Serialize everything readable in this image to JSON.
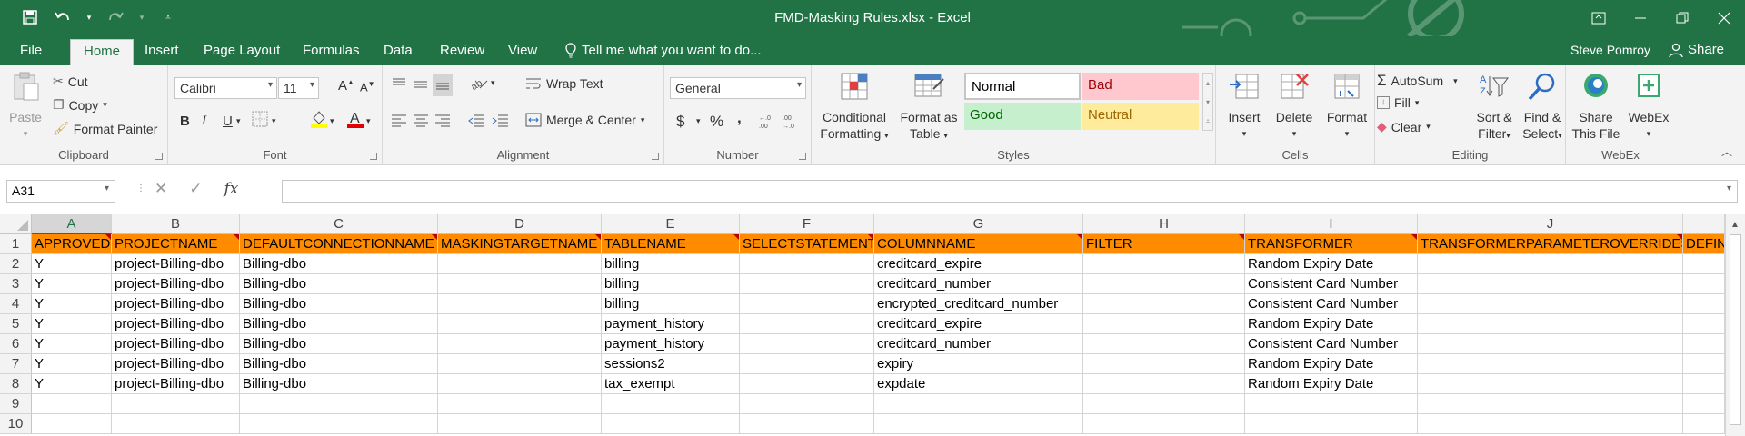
{
  "window": {
    "title": "FMD-Masking Rules.xlsx - Excel",
    "accent": "#217346"
  },
  "menu": {
    "file": "File",
    "tabs": [
      "Home",
      "Insert",
      "Page Layout",
      "Formulas",
      "Data",
      "Review",
      "View"
    ],
    "tell_me": "Tell me what you want to do...",
    "user": "Steve Pomroy",
    "share": "Share"
  },
  "ribbon": {
    "clipboard": {
      "label": "Clipboard",
      "paste": "Paste",
      "cut": "Cut",
      "copy": "Copy",
      "format_painter": "Format Painter"
    },
    "font": {
      "label": "Font",
      "name": "Calibri",
      "size": "11",
      "bold": "B",
      "italic": "I",
      "underline": "U"
    },
    "alignment": {
      "label": "Alignment",
      "wrap_text": "Wrap Text",
      "merge_center": "Merge & Center"
    },
    "number": {
      "label": "Number",
      "format": "General",
      "currency": "$",
      "percent": "%",
      "comma": ","
    },
    "styles": {
      "label": "Styles",
      "conditional_formatting": [
        "Conditional",
        "Formatting"
      ],
      "format_as_table": [
        "Format as",
        "Table"
      ],
      "normal": "Normal",
      "bad": "Bad",
      "good": "Good",
      "neutral": "Neutral"
    },
    "cells": {
      "label": "Cells",
      "insert": "Insert",
      "delete": "Delete",
      "format": "Format"
    },
    "editing": {
      "label": "Editing",
      "autosum": "AutoSum",
      "fill": "Fill",
      "clear": "Clear",
      "sort_filter": [
        "Sort &",
        "Filter"
      ],
      "find_select": [
        "Find &",
        "Select"
      ]
    },
    "webex": {
      "label": "WebEx",
      "share_file": [
        "Share",
        "This File"
      ],
      "webex": "WebEx"
    }
  },
  "formula_bar": {
    "name_box": "A31",
    "fx": "fx",
    "formula": ""
  },
  "sheet": {
    "selected_column": "A",
    "columns": [
      "A",
      "B",
      "C",
      "D",
      "E",
      "F",
      "G",
      "H",
      "I",
      "J"
    ],
    "row_numbers": [
      "1",
      "2",
      "3",
      "4",
      "5",
      "6",
      "7",
      "8",
      "9",
      "10"
    ],
    "header_row": [
      "APPROVED",
      "PROJECTNAME",
      "DEFAULTCONNECTIONNAME",
      "MASKINGTARGETNAME",
      "TABLENAME",
      "SELECTSTATEMENT",
      "COLUMNNAME",
      "FILTER",
      "TRANSFORMER",
      "TRANSFORMERPARAMETEROVERRIDES",
      "DEFIN"
    ],
    "rows": [
      [
        "Y",
        "project-Billing-dbo",
        "Billing-dbo",
        "",
        "billing",
        "",
        "creditcard_expire",
        "",
        "Random Expiry Date",
        "",
        ""
      ],
      [
        "Y",
        "project-Billing-dbo",
        "Billing-dbo",
        "",
        "billing",
        "",
        "creditcard_number",
        "",
        "Consistent Card Number",
        "",
        ""
      ],
      [
        "Y",
        "project-Billing-dbo",
        "Billing-dbo",
        "",
        "billing",
        "",
        "encrypted_creditcard_number",
        "",
        "Consistent Card Number",
        "",
        ""
      ],
      [
        "Y",
        "project-Billing-dbo",
        "Billing-dbo",
        "",
        "payment_history",
        "",
        "creditcard_expire",
        "",
        "Random Expiry Date",
        "",
        ""
      ],
      [
        "Y",
        "project-Billing-dbo",
        "Billing-dbo",
        "",
        "payment_history",
        "",
        "creditcard_number",
        "",
        "Consistent Card Number",
        "",
        ""
      ],
      [
        "Y",
        "project-Billing-dbo",
        "Billing-dbo",
        "",
        "sessions2",
        "",
        "expiry",
        "",
        "Random Expiry Date",
        "",
        ""
      ],
      [
        "Y",
        "project-Billing-dbo",
        "Billing-dbo",
        "",
        "tax_exempt",
        "",
        "expdate",
        "",
        "Random Expiry Date",
        "",
        ""
      ],
      [
        "",
        "",
        "",
        "",
        "",
        "",
        "",
        "",
        "",
        "",
        ""
      ],
      [
        "",
        "",
        "",
        "",
        "",
        "",
        "",
        "",
        "",
        "",
        ""
      ]
    ],
    "header_color": "#ff8c00"
  }
}
